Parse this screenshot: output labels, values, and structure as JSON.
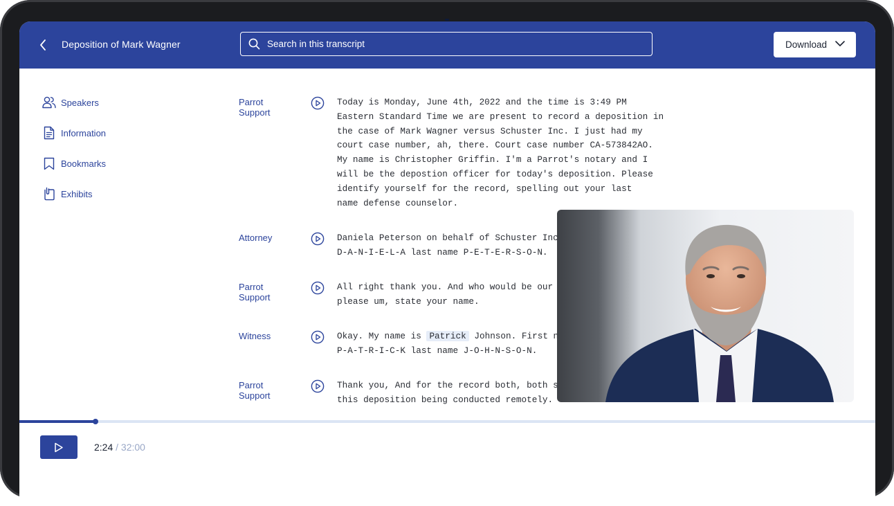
{
  "header": {
    "title": "Deposition of Mark Wagner",
    "search_placeholder": "Search in this transcript",
    "download_label": "Download"
  },
  "sidebar": {
    "items": [
      {
        "label": "Speakers",
        "icon": "speakers-icon"
      },
      {
        "label": "Information",
        "icon": "document-icon"
      },
      {
        "label": "Bookmarks",
        "icon": "bookmark-icon"
      },
      {
        "label": "Exhibits",
        "icon": "exhibit-icon"
      }
    ]
  },
  "transcript": [
    {
      "speaker": "Parrot Support",
      "text": "Today is Monday, June 4th, 2022 and the time is 3:49 PM\nEastern Standard Time we are present to record a deposition in\nthe case of Mark Wagner versus Schuster Inc. I just had my\ncourt case number, ah, there. Court case number CA-573842AO.\nMy name is Christopher Griffin. I'm a Parrot's notary and I\nwill be the depostion officer for today's deposition. Please\nidentify yourself for the record, spelling out your last\nname defense counselor."
    },
    {
      "speaker": "Attorney",
      "text": "Daniela Peterson on behalf of Schuster Inc\nD-A-N-I-E-L-A last name P-E-T-E-R-S-O-N."
    },
    {
      "speaker": "Parrot Support",
      "text": "All right thank you. And who would be our d\nplease um, state your name."
    },
    {
      "speaker": "Witness",
      "text_before": "Okay. My name is ",
      "highlight": "Patrick",
      "text_after": " Johnson. First nam\nP-A-T-R-I-C-K last name J-O-H-N-S-O-N."
    },
    {
      "speaker": "Parrot Support",
      "text": "Thank you, And for the record both, both si\nthis deposition being conducted remotely."
    }
  ],
  "player": {
    "current_time": "2:24",
    "separator": "/",
    "total_time": "32:00",
    "progress": 0.0892
  },
  "colors": {
    "brand": "#2c449c",
    "track": "#dbe5f4",
    "highlight": "#e6edf8"
  }
}
